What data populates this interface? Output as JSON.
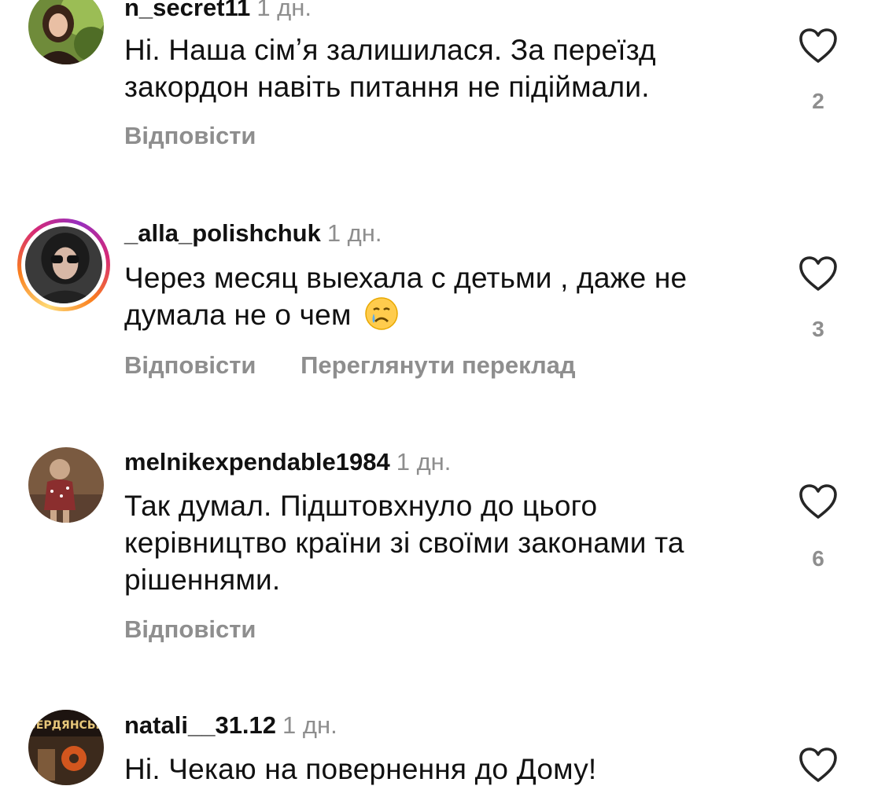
{
  "comments": [
    {
      "username": "n_secret11",
      "time": "1 дн.",
      "text_line1": "Ні. Наша сімʼя залишилася. За переїзд",
      "text_line2": "закордон  навіть питання не підіймали.",
      "reply_label": "Відповісти",
      "likes": "2"
    },
    {
      "username": "_alla_polishchuk",
      "time": "1 дн.",
      "text_line1": "Через месяц выехала с детьми , даже не",
      "text_line2": "думала не о чем",
      "emoji": "crying-face-icon",
      "reply_label": "Відповісти",
      "translate_label": "Переглянути переклад",
      "likes": "3"
    },
    {
      "username": "melnikexpendable1984",
      "time": "1 дн.",
      "text_line1": "Так думал. Підштовхнуло до цього",
      "text_line2": "керівництво країни зі своїми законами та",
      "text_line3": "рішеннями.",
      "reply_label": "Відповісти",
      "likes": "6"
    },
    {
      "username": "natali__31.12",
      "time": "1 дн.",
      "text_line1": "Ні. Чекаю на повернення до Дому!",
      "avatar_text": "БЕРДЯНСЬК"
    }
  ],
  "icons": {
    "like": "heart-outline-icon"
  },
  "colors": {
    "text": "#111111",
    "secondary": "#8e8e8e",
    "background": "#ffffff"
  }
}
